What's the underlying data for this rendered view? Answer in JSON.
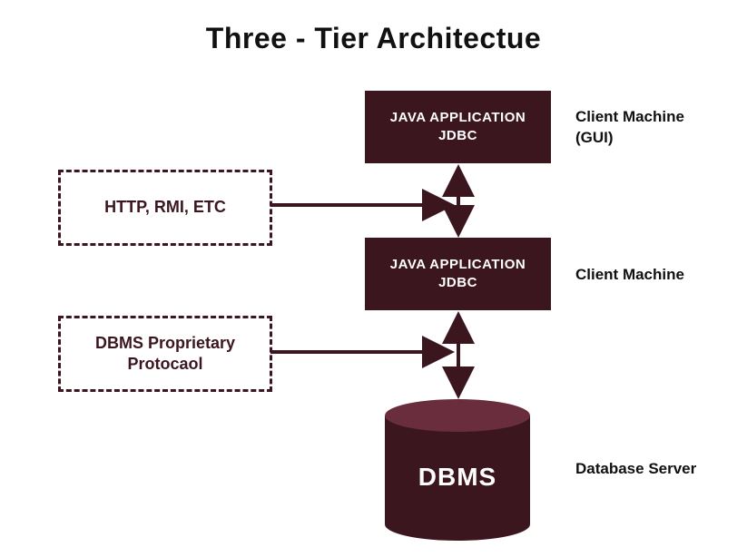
{
  "title": "Three - Tier Architectue",
  "tier1": {
    "line1": "JAVA APPLICATION",
    "line2": "JDBC"
  },
  "tier2": {
    "line1": "JAVA APPLICATION",
    "line2": "JDBC"
  },
  "dashed1": "HTTP, RMI, ETC",
  "dashed2": "DBMS Proprietary Protocaol",
  "rightLabels": {
    "l1a": "Client Machine",
    "l1b": "(GUI)",
    "l2": "Client Machine",
    "l3": "Database Server"
  },
  "db": "DBMS"
}
